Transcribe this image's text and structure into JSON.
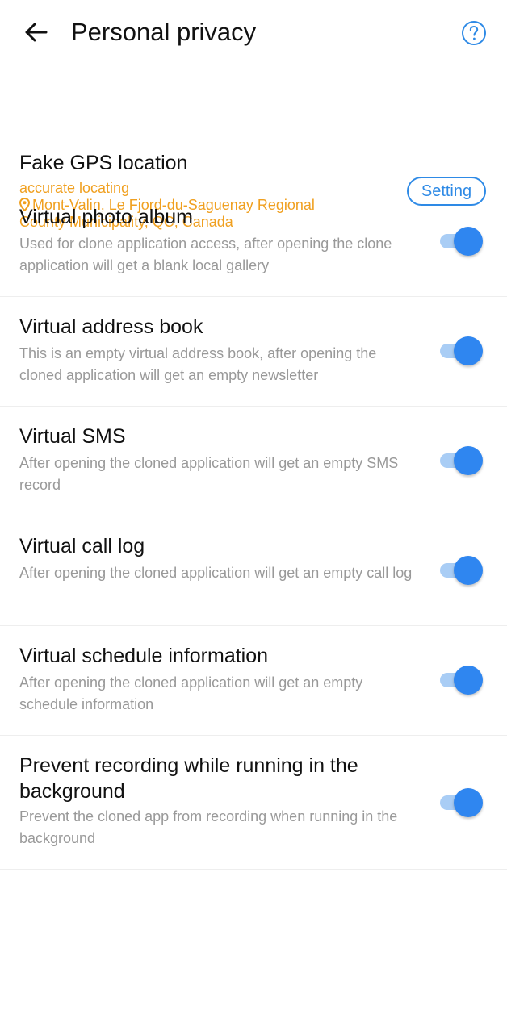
{
  "header": {
    "title": "Personal privacy",
    "back_icon": "arrow-left-icon",
    "help_icon": "question-circle-icon"
  },
  "gps": {
    "title": "Fake GPS location",
    "mode": "accurate locating",
    "location": "Mont-Valin, Le Fjord-du-Saguenay Regional County Municipality, QC, Canada",
    "location_icon": "map-pin-icon",
    "setting_label": "Setting"
  },
  "settings": [
    {
      "title": "Virtual photo album",
      "description": "Used for clone application access, after opening the clone application will get a blank local gallery",
      "enabled": true
    },
    {
      "title": "Virtual address book",
      "description": "This is an empty virtual address book, after opening the cloned application will get an empty newsletter",
      "enabled": true
    },
    {
      "title": "Virtual SMS",
      "description": "After opening the cloned application will get an empty SMS record",
      "enabled": true
    },
    {
      "title": "Virtual call log",
      "description": "After opening the cloned application will get an empty call log",
      "enabled": true
    },
    {
      "title": "Virtual schedule information",
      "description": "After opening the cloned application will get an empty schedule information",
      "enabled": true
    },
    {
      "title": "Prevent recording while running in the background",
      "description": "Prevent the cloned app from recording when running in the background",
      "enabled": true
    }
  ],
  "colors": {
    "accent": "#2f86f0",
    "track": "#a9cdf5",
    "location_text": "#f0a020",
    "description_text": "#999999"
  }
}
